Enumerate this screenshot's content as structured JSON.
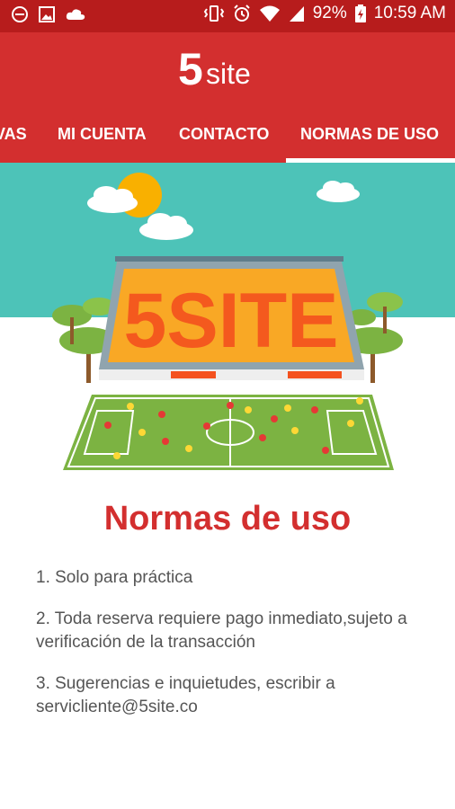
{
  "status_bar": {
    "battery": "92%",
    "time": "10:59 AM",
    "left_icons": [
      "minus-circle-icon",
      "image-icon",
      "cloud-icon"
    ],
    "right_icons": [
      "vibrate-icon",
      "alarm-icon",
      "wifi-icon",
      "signal-icon",
      "battery-charging-icon"
    ]
  },
  "app": {
    "logo_text": "5site",
    "accent_color": "#d32f2f"
  },
  "tabs": [
    {
      "label": "VAS"
    },
    {
      "label": "MI CUENTA"
    },
    {
      "label": "CONTACTO"
    },
    {
      "label": "NORMAS DE USO",
      "active": true
    }
  ],
  "hero": {
    "stadium_sign": "5SITE"
  },
  "content": {
    "title": "Normas de uso",
    "rules": [
      "1. Solo para práctica",
      "2. Toda reserva requiere pago inmediato,sujeto a verificación de la transacción",
      "3. Sugerencias e inquietudes, escribir a servicliente@5site.co"
    ]
  }
}
